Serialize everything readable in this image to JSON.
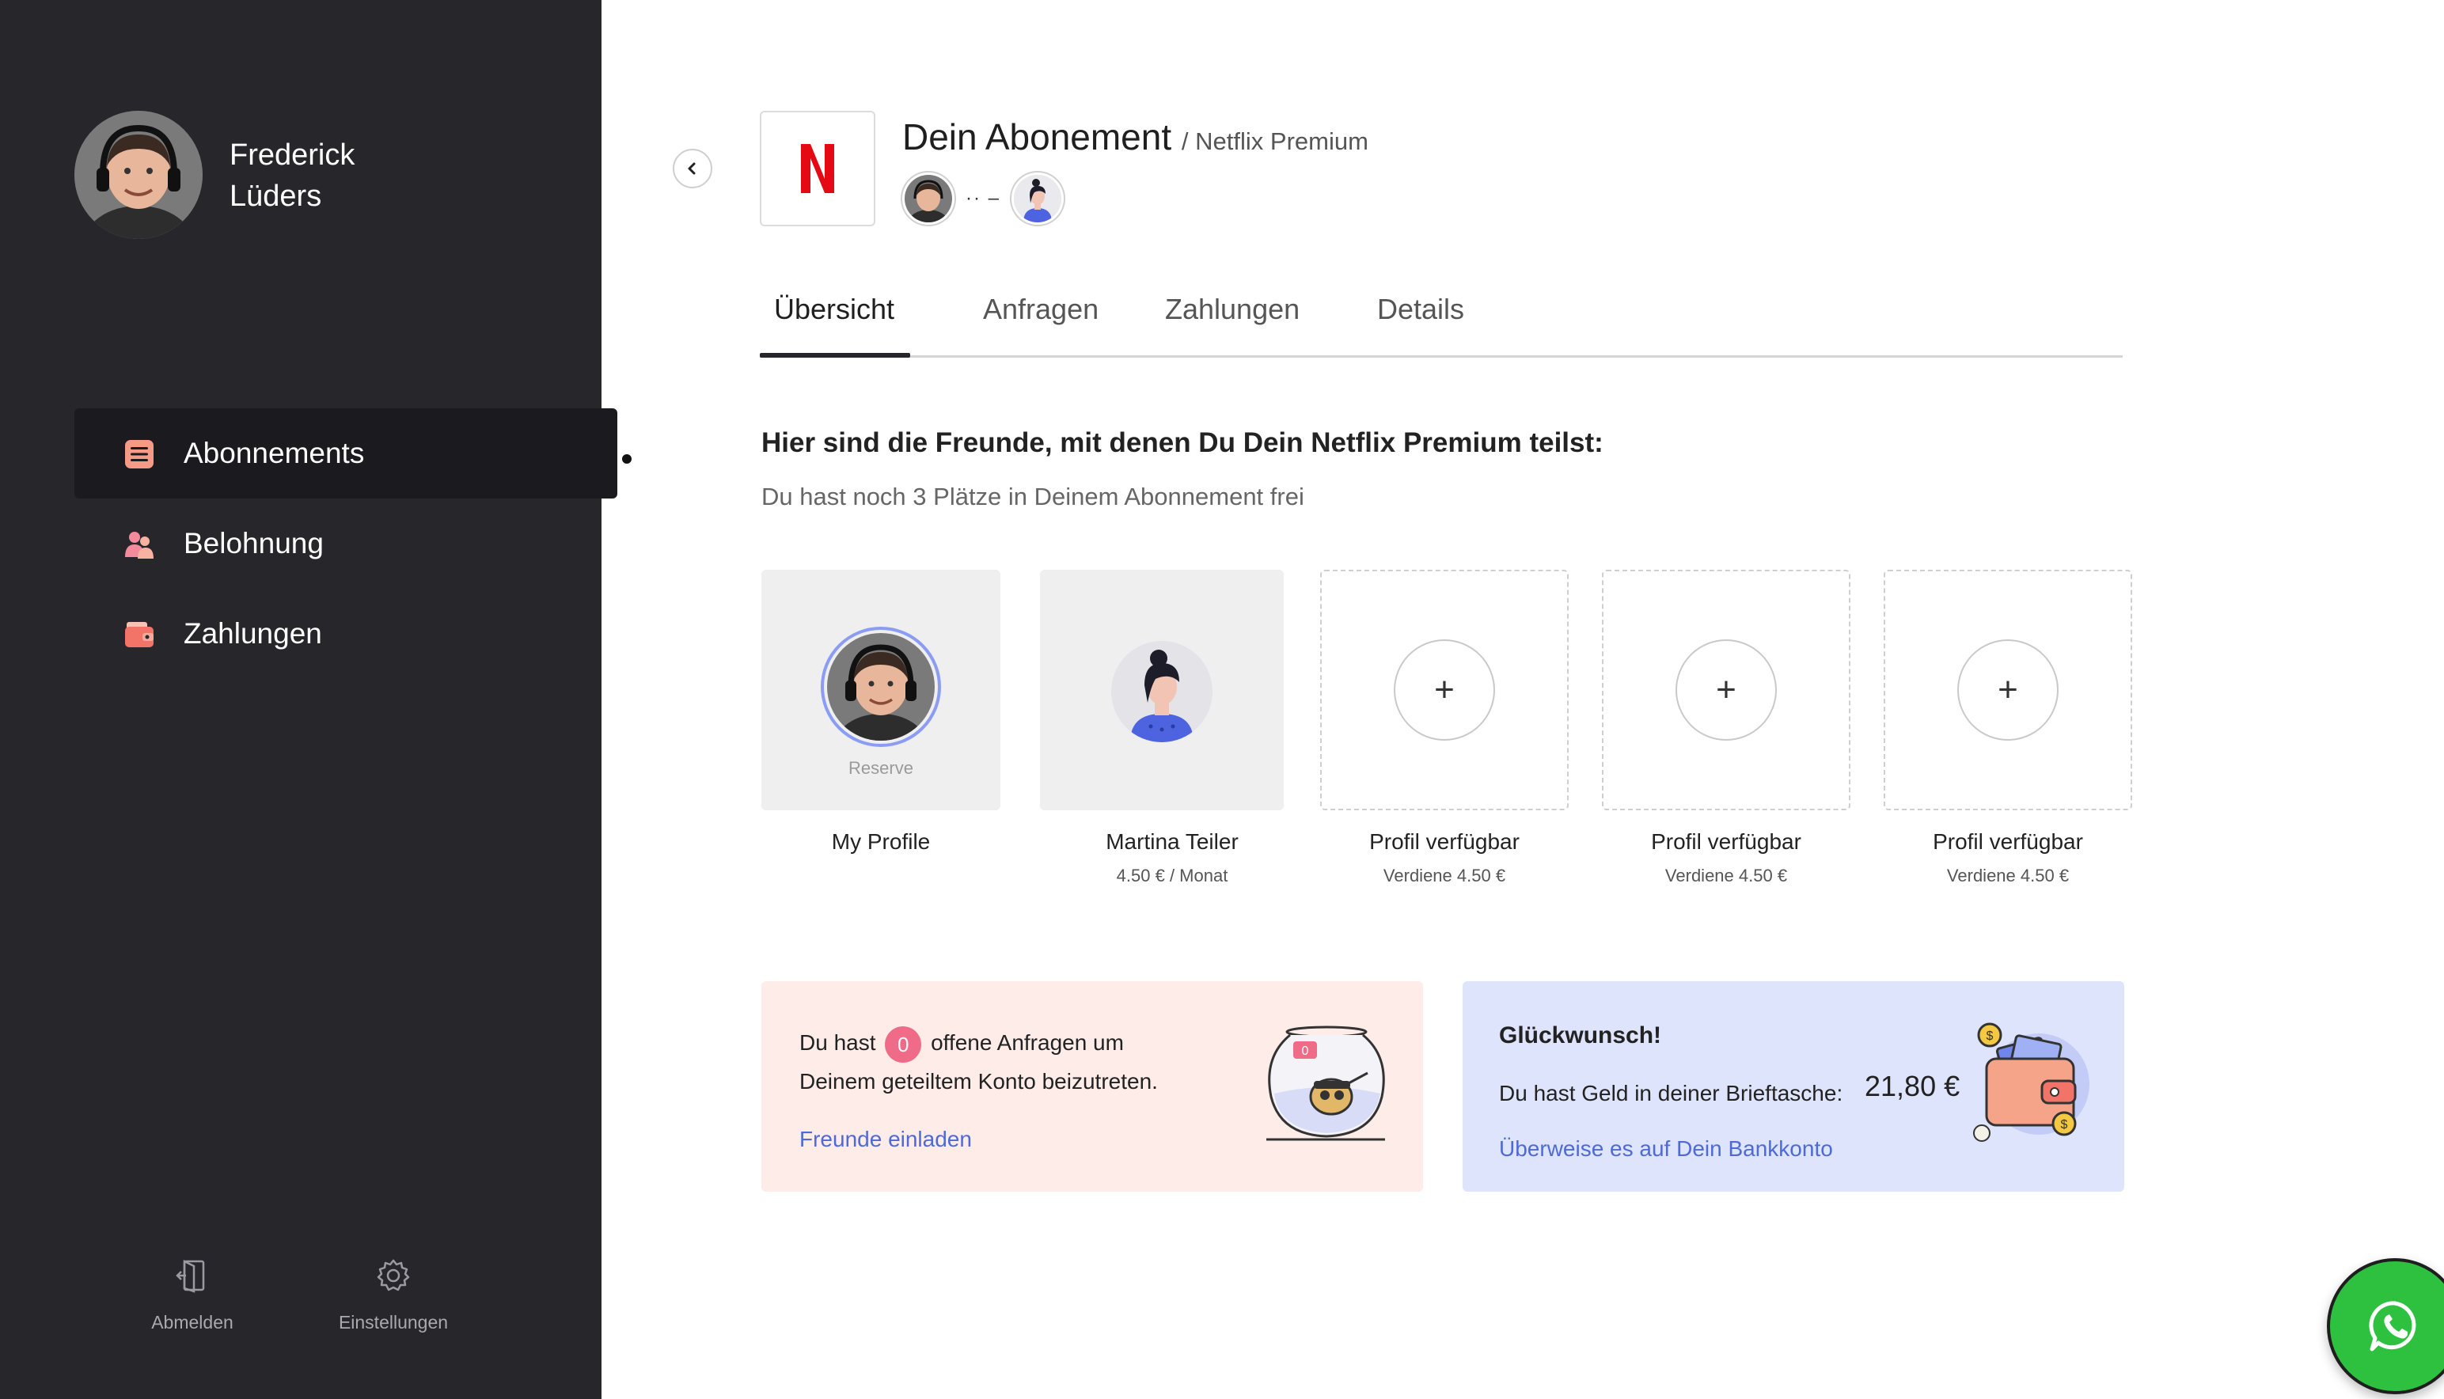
{
  "user": {
    "first_name": "Frederick",
    "last_name": "Lüders"
  },
  "nav": {
    "items": [
      {
        "label": "Abonnements",
        "icon": "list-icon",
        "active": true
      },
      {
        "label": "Belohnung",
        "icon": "users-icon",
        "active": false
      },
      {
        "label": "Zahlungen",
        "icon": "wallet-icon",
        "active": false
      }
    ],
    "footer": [
      {
        "label": "Abmelden",
        "icon": "logout-icon"
      },
      {
        "label": "Einstellungen",
        "icon": "gear-icon"
      }
    ]
  },
  "header": {
    "title": "Dein Abonement",
    "subtitle": "/ Netflix Premium",
    "logo_letter": "N",
    "mini_separator": "·· –"
  },
  "tabs": [
    {
      "label": "Übersicht",
      "active": true
    },
    {
      "label": "Anfragen",
      "active": false
    },
    {
      "label": "Zahlungen",
      "active": false
    },
    {
      "label": "Details",
      "active": false
    }
  ],
  "main": {
    "heading": "Hier sind die Freunde, mit denen Du Dein Netflix Premium teilst:",
    "subheading": "Du hast noch 3 Plätze in Deinem Abonnement frei"
  },
  "slots": [
    {
      "name": "My Profile",
      "sub": "",
      "tag": "Reserve",
      "kind": "me"
    },
    {
      "name": "Martina Teiler",
      "sub": "4.50 € / Monat",
      "kind": "friend"
    },
    {
      "name": "Profil verfügbar",
      "sub": "Verdiene 4.50 €",
      "kind": "empty",
      "plus": "+"
    },
    {
      "name": "Profil verfügbar",
      "sub": "Verdiene 4.50 €",
      "kind": "empty",
      "plus": "+"
    },
    {
      "name": "Profil verfügbar",
      "sub": "Verdiene 4.50 €",
      "kind": "empty",
      "plus": "+"
    }
  ],
  "requests_card": {
    "text_before": "Du hast",
    "count": "0",
    "text_after": "offene Anfragen um",
    "line2": "Deinem geteiltem Konto beizutreten.",
    "link": "Freunde einladen"
  },
  "wallet_card": {
    "title": "Glückwunsch!",
    "text": "Du hast Geld in deiner Brieftasche:",
    "amount": "21,80 €",
    "link": "Überweise es auf Dein Bankkonto"
  },
  "colors": {
    "sidebar": "#26262b",
    "accent_pink": "#f06b88",
    "link_blue": "#4d6ad6",
    "netflix_red": "#e50914",
    "whatsapp_green": "#2ec13f"
  }
}
